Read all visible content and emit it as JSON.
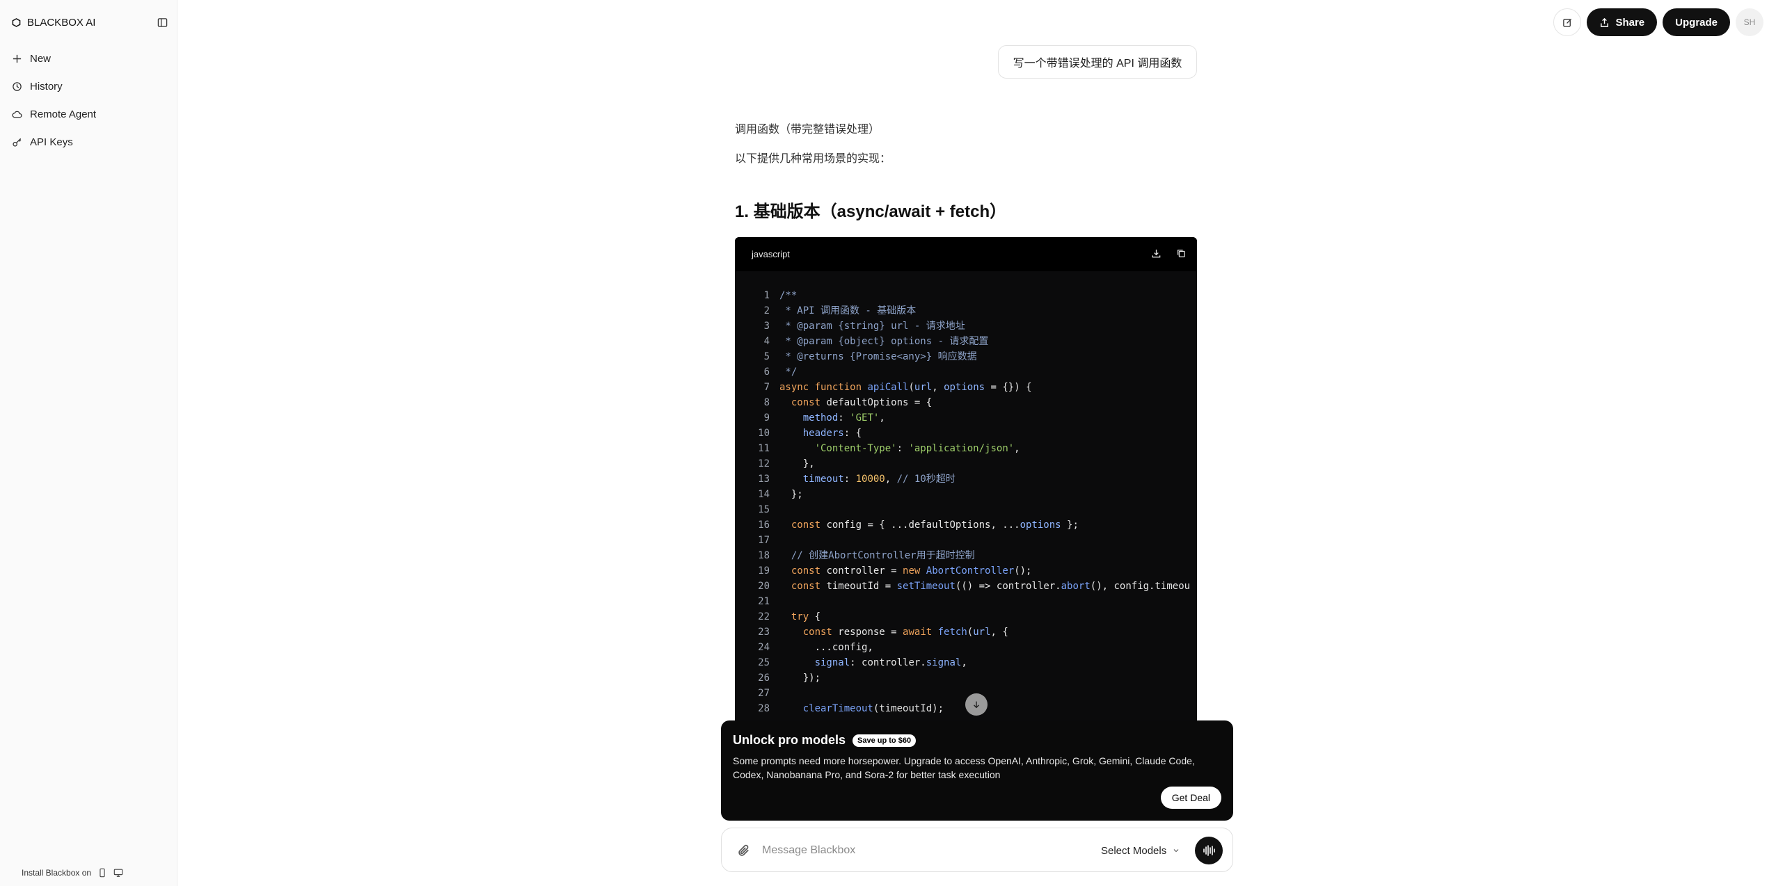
{
  "sidebar": {
    "brand": "BLACKBOX AI",
    "items": [
      {
        "label": "New",
        "icon": "plus-icon"
      },
      {
        "label": "History",
        "icon": "history-icon"
      },
      {
        "label": "Remote Agent",
        "icon": "cloud-icon"
      },
      {
        "label": "API Keys",
        "icon": "key-icon"
      }
    ],
    "install_label": "Install Blackbox on"
  },
  "topbar": {
    "share_label": "Share",
    "upgrade_label": "Upgrade",
    "avatar_initials": "SH"
  },
  "chat": {
    "user_message": "写一个带错误处理的 API 调用函数",
    "para1": "调用函数（带完整错误处理）",
    "para2": "以下提供几种常用场景的实现：",
    "heading": "1. 基础版本（async/await + fetch）",
    "code_lang": "javascript",
    "code_lines": [
      "/**",
      " * API 调用函数 - 基础版本",
      " * @param {string} url - 请求地址",
      " * @param {object} options - 请求配置",
      " * @returns {Promise<any>} 响应数据",
      " */",
      "async function apiCall(url, options = {}) {",
      "  const defaultOptions = {",
      "    method: 'GET',",
      "    headers: {",
      "      'Content-Type': 'application/json',",
      "    },",
      "    timeout: 10000, // 10秒超时",
      "  };",
      "",
      "  const config = { ...defaultOptions, ...options };",
      "",
      "  // 创建AbortController用于超时控制",
      "  const controller = new AbortController();",
      "  const timeoutId = setTimeout(() => controller.abort(), config.timeou",
      "",
      "  try {",
      "    const response = await fetch(url, {",
      "      ...config,",
      "      signal: controller.signal,",
      "    });",
      "",
      "    clearTimeout(timeoutId);"
    ]
  },
  "promo": {
    "title": "Unlock pro models",
    "badge": "Save up to $60",
    "description": "Some prompts need more horsepower. Upgrade to access OpenAI, Anthropic, Grok, Gemini, Claude Code, Codex, Nanobanana Pro, and Sora-2 for better task execution",
    "cta": "Get Deal"
  },
  "input": {
    "placeholder": "Message Blackbox",
    "model_label": "Select Models"
  }
}
